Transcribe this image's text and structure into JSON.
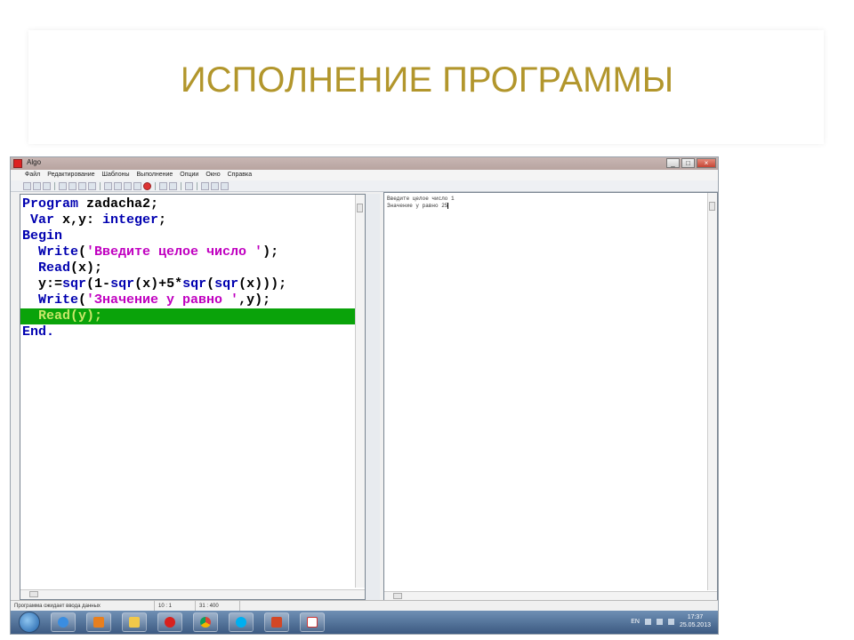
{
  "slide": {
    "title": "ИСПОЛНЕНИЕ ПРОГРАММЫ"
  },
  "window": {
    "title": "Algo",
    "controls": {
      "minimize": "_",
      "maximize": "□",
      "close": "×"
    }
  },
  "menu": {
    "items": [
      "Файл",
      "Редактирование",
      "Шаблоны",
      "Выполнение",
      "Опции",
      "Окно",
      "Справка"
    ]
  },
  "editor": {
    "lines": [
      {
        "kw": "Program",
        "rest": " zadacha2;"
      },
      {
        "kw": " Var",
        "rest": " x,y: ",
        "kw2": "integer",
        "rest2": ";"
      },
      {
        "kw": "Begin",
        "rest": ""
      },
      {
        "kw": "  Write",
        "rest": "(",
        "str": "'Введите целое число '",
        "rest2": ");"
      },
      {
        "kw": "  Read",
        "rest": "(x);"
      },
      {
        "kw": "  y",
        "rest": ":=",
        "kw2": "sqr",
        "rest2": "(1-",
        "kw3": "sqr",
        "rest3": "(x)+5*",
        "kw4": "sqr",
        "rest4": "(",
        "kw5": "sqr",
        "rest5": "(x)));"
      },
      {
        "kw": "  Write",
        "rest": "(",
        "str": "'Значение y равно '",
        "rest2": ",y);"
      },
      {
        "kw": "  Read(y);",
        "rest": "",
        "highlight": true
      },
      {
        "kw": "End.",
        "rest": ""
      }
    ],
    "highlight_color": "#0aa30a"
  },
  "output": {
    "lines": [
      "Введите целое число 1",
      "Значение y равно 25"
    ]
  },
  "status": {
    "message": "Программа ожидает ввода данных",
    "position": "10 :  1",
    "count": "31 : 400"
  },
  "taskbar": {
    "apps": [
      "internet-explorer",
      "media-player",
      "file-explorer",
      "opera",
      "chrome",
      "skype",
      "powerpoint",
      "algo"
    ],
    "language": "EN",
    "time": "17:37",
    "date": "25.05.2013"
  }
}
